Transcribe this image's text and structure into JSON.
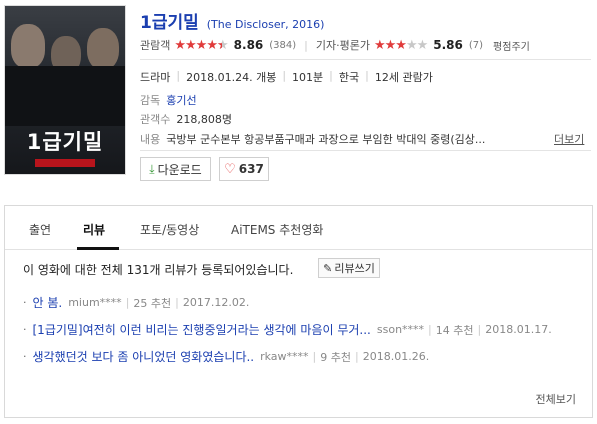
{
  "movie": {
    "title": "1급기밀",
    "original_title": "(The Discloser, 2016)",
    "poster_title": "1급기밀"
  },
  "ratings": {
    "audience_label": "관람객",
    "audience_score": "8.86",
    "audience_count": "(384)",
    "audience_stars": 4.5,
    "critic_label": "기자·평론가",
    "critic_score": "5.86",
    "critic_count": "(7)",
    "critic_stars": 3,
    "rate_label": "평점주기"
  },
  "info": {
    "genre": "드라마",
    "release": "2018.01.24. 개봉",
    "runtime": "101분",
    "country": "한국",
    "rating": "12세 관람가",
    "director_label": "감독",
    "director": "홍기선",
    "audience_label": "관객수",
    "audience": "218,808명",
    "plot_label": "내용",
    "plot": "국방부 군수본부 항공부품구매과 과장으로 부임한 박대익 중령(김상...",
    "more_label": "더보기"
  },
  "buttons": {
    "download": "다운로드",
    "like_count": "637"
  },
  "tabs": [
    "출연",
    "리뷰",
    "포토/동영상",
    "AiTEMS 추천영화"
  ],
  "review_summary": {
    "text": "이 영화에 대한 전체 131개 리뷰가 등록되어있습니다.",
    "write_label": "리뷰쓰기"
  },
  "reviews": [
    {
      "title": "안 봄.",
      "author": "mium****",
      "recommend": "25 추천",
      "date": "2017.12.02."
    },
    {
      "title": "[1급기밀]여전히 이런 비리는 진행중일거라는 생각에 마음이 무거...",
      "author": "sson****",
      "recommend": "14 추천",
      "date": "2018.01.17."
    },
    {
      "title": "생각했던것 보다 좀 아니었던 영화였습니다..",
      "author": "rkaw****",
      "recommend": "9 추천",
      "date": "2018.01.26."
    }
  ],
  "view_all": "전체보기"
}
